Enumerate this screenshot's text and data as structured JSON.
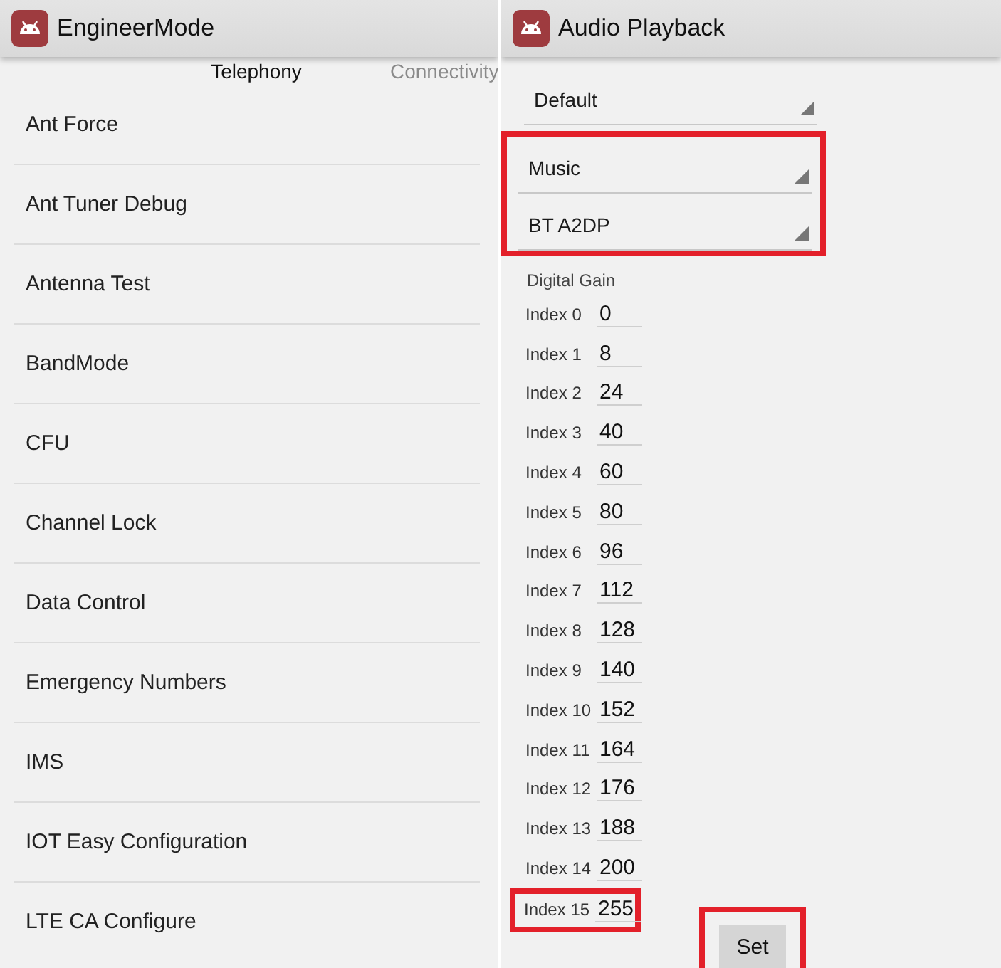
{
  "left_panel": {
    "app_bar": {
      "title": "EngineerMode"
    },
    "tabs": [
      {
        "label": "Telephony",
        "selected": true
      },
      {
        "label": "Connectivity",
        "selected": false
      }
    ],
    "items": [
      "Ant Force",
      "Ant Tuner Debug",
      "Antenna Test",
      "BandMode",
      "CFU",
      "Channel Lock",
      "Data Control",
      "Emergency Numbers",
      "IMS",
      "IOT Easy Configuration",
      "LTE CA Configure"
    ]
  },
  "right_panel": {
    "app_bar": {
      "title": "Audio Playback"
    },
    "spinners": [
      {
        "value": "Default",
        "highlighted": false
      },
      {
        "value": "Music",
        "highlighted": true
      },
      {
        "value": "BT A2DP",
        "highlighted": true
      }
    ],
    "section_label": "Digital Gain",
    "gains": [
      {
        "label": "Index 0",
        "value": "0",
        "highlighted": false
      },
      {
        "label": "Index 1",
        "value": "8",
        "highlighted": false
      },
      {
        "label": "Index 2",
        "value": "24",
        "highlighted": false
      },
      {
        "label": "Index 3",
        "value": "40",
        "highlighted": false
      },
      {
        "label": "Index 4",
        "value": "60",
        "highlighted": false
      },
      {
        "label": "Index 5",
        "value": "80",
        "highlighted": false
      },
      {
        "label": "Index 6",
        "value": "96",
        "highlighted": false
      },
      {
        "label": "Index 7",
        "value": "112",
        "highlighted": false
      },
      {
        "label": "Index 8",
        "value": "128",
        "highlighted": false
      },
      {
        "label": "Index 9",
        "value": "140",
        "highlighted": false
      },
      {
        "label": "Index 10",
        "value": "152",
        "highlighted": false
      },
      {
        "label": "Index 11",
        "value": "164",
        "highlighted": false
      },
      {
        "label": "Index 12",
        "value": "176",
        "highlighted": false
      },
      {
        "label": "Index 13",
        "value": "188",
        "highlighted": false
      },
      {
        "label": "Index 14",
        "value": "200",
        "highlighted": false
      },
      {
        "label": "Index 15",
        "value": "255",
        "highlighted": true
      }
    ],
    "button": {
      "label": "Set",
      "highlighted": true
    }
  }
}
